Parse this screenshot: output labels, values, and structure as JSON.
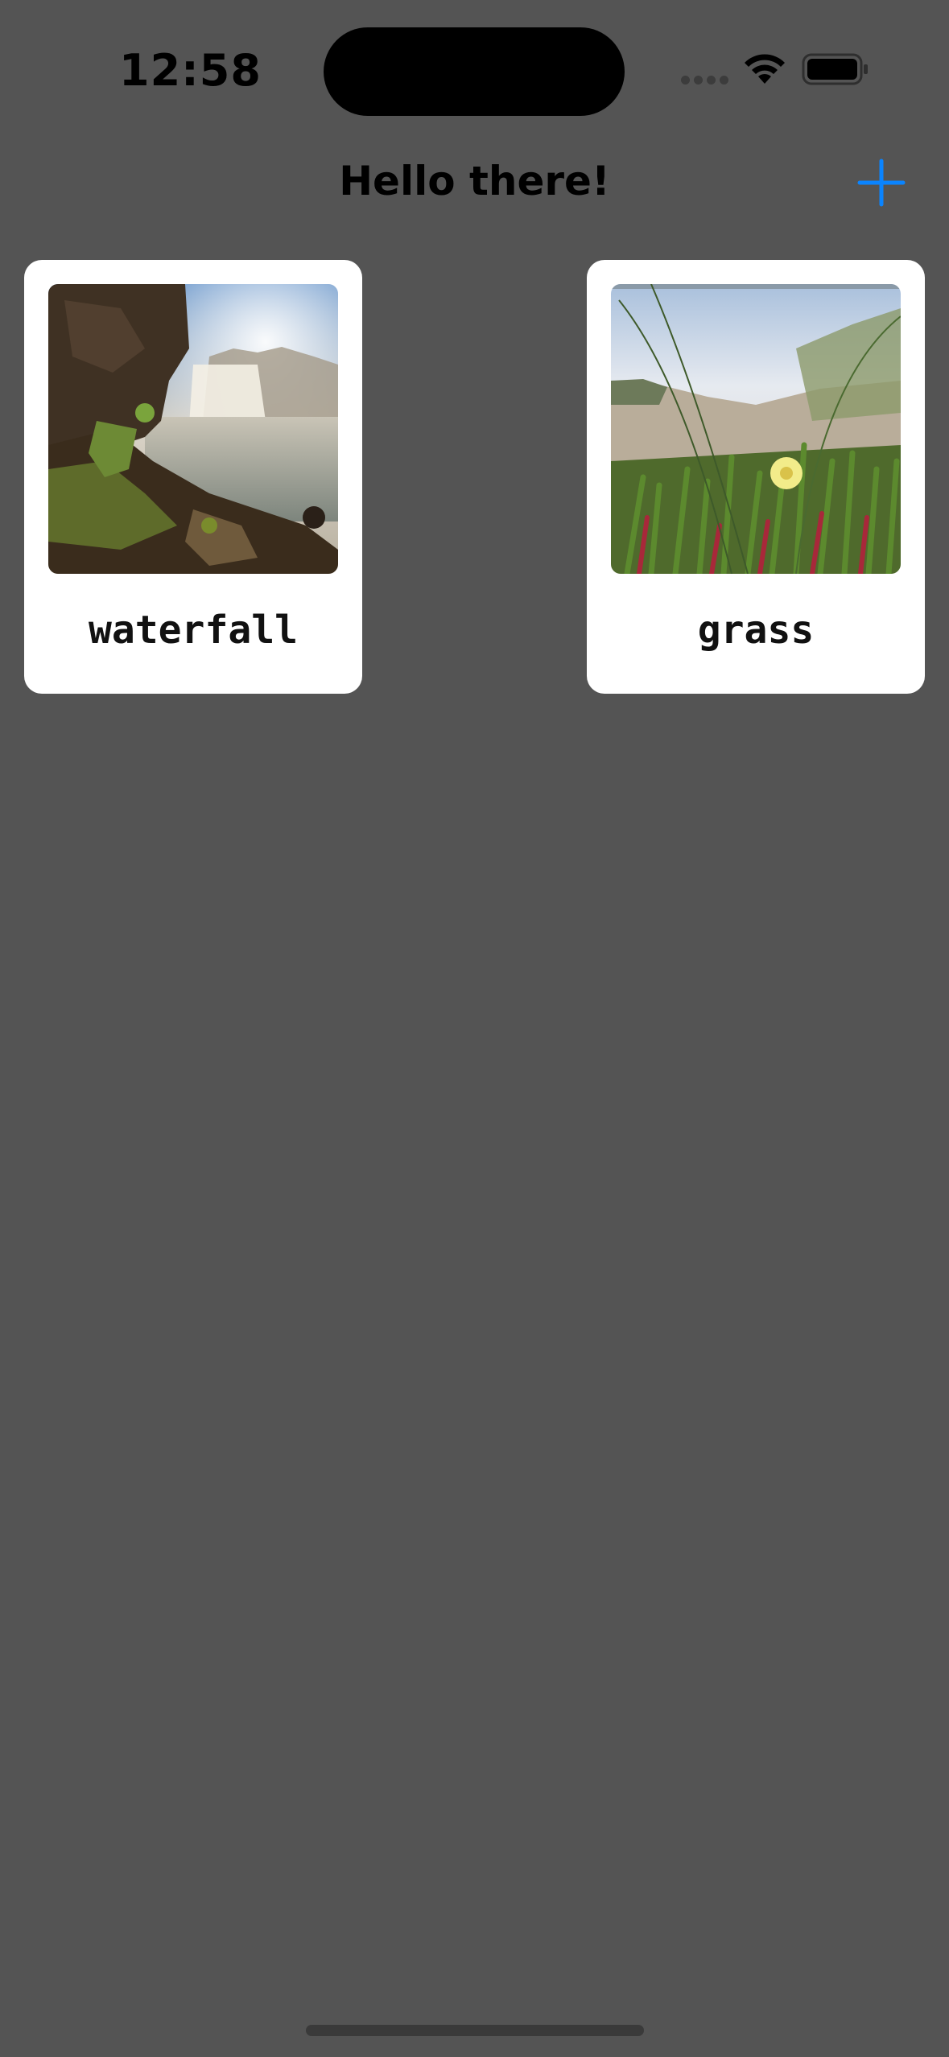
{
  "status_bar": {
    "time": "12:58",
    "icons": [
      "cellular-signal-icon",
      "wifi-icon",
      "battery-icon"
    ]
  },
  "header": {
    "title": "Hello there!",
    "add_icon": "plus-icon",
    "accent_color": "#0a84ff"
  },
  "cards": [
    {
      "label": "waterfall",
      "image": "waterfall photo"
    },
    {
      "label": "grass",
      "image": "grass photo"
    }
  ],
  "colors": {
    "background": "#545454",
    "card": "#ffffff"
  }
}
